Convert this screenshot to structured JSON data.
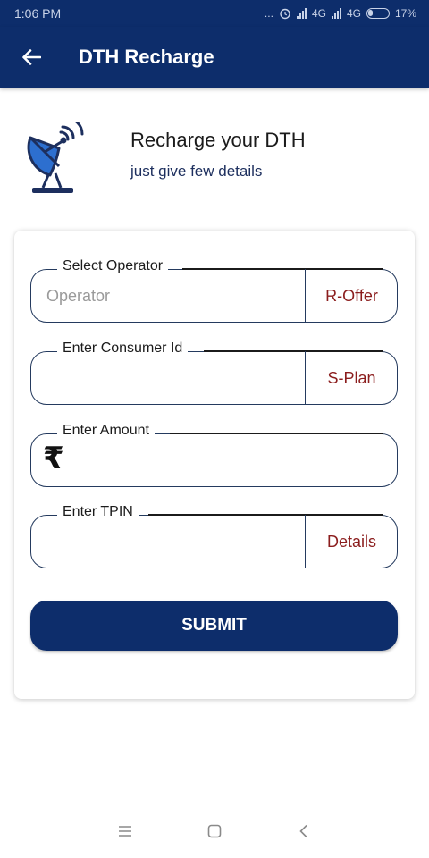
{
  "status_bar": {
    "time": "1:06 PM",
    "dots": "...",
    "network_1": "4G",
    "network_2": "4G",
    "battery": "17%",
    "bar_color": "#0d2d6b"
  },
  "app_bar": {
    "title": "DTH Recharge",
    "back_icon": "arrow-left-icon"
  },
  "hero": {
    "icon": "satellite-dish-icon",
    "title": "Recharge your DTH",
    "subtitle": "just give few details"
  },
  "form": {
    "operator": {
      "label": "Select Operator",
      "placeholder": "Operator",
      "action": "R-Offer"
    },
    "consumer_id": {
      "label": "Enter Consumer Id",
      "value": "",
      "action": "S-Plan"
    },
    "amount": {
      "label": "Enter Amount",
      "currency_symbol": "₹",
      "value": ""
    },
    "tpin": {
      "label": "Enter TPIN",
      "value": "",
      "action": "Details"
    },
    "submit_label": "SUBMIT"
  },
  "colors": {
    "primary": "#0d2d6b",
    "action_text": "#8b1d1d",
    "border": "#243a5e"
  },
  "nav_bar": {
    "recents_icon": "menu-lines-icon",
    "home_icon": "square-home-icon",
    "back_icon": "chevron-left-icon"
  }
}
